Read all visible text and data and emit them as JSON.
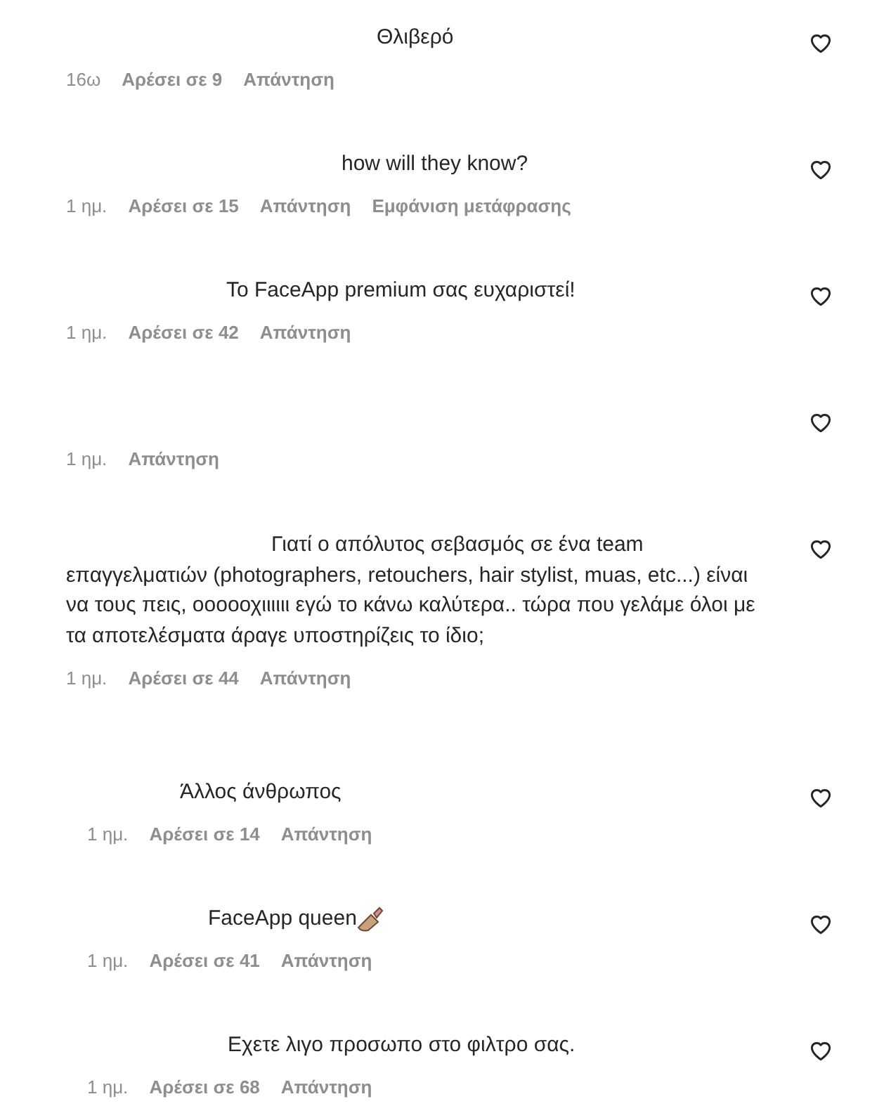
{
  "comments": [
    {
      "kind": "comment",
      "text": "Θλιβερό",
      "time": "16ω",
      "likes": "Αρέσει σε 9",
      "reply": "Απάντηση"
    },
    {
      "kind": "comment",
      "text": "how will they know?",
      "time": "1 ημ.",
      "likes": "Αρέσει σε 15",
      "reply": "Απάντηση",
      "translate": "Εμφάνιση μετάφρασης"
    },
    {
      "kind": "comment",
      "text": "Το FaceApp premium σας ευχαριστεί!",
      "time": "1 ημ.",
      "likes": "Αρέσει σε 42",
      "reply": "Απάντηση"
    },
    {
      "kind": "comment",
      "time": "1 ημ.",
      "reply": "Απάντηση"
    },
    {
      "kind": "comment",
      "text": "Γιατί ο απόλυτος σεβασμός σε ένα team επαγγελματιών (photographers, retouchers, hair stylist, muas, etc...) είναι να τους πεις, οοοοοχιιιιιι εγώ το κάνω καλύτερα.. τώρα που γελάμε όλοι με τα αποτελέσματα άραγε υποστηρίζεις το ίδιο;",
      "time": "1 ημ.",
      "likes": "Αρέσει σε 44",
      "reply": "Απάντηση"
    },
    {
      "kind": "reply",
      "text": "Άλλος άνθρωπος",
      "time": "1 ημ.",
      "likes": "Αρέσει σε 14",
      "reply": "Απάντηση"
    },
    {
      "kind": "reply",
      "text": "FaceApp queen",
      "emoji": true,
      "time": "1 ημ.",
      "likes": "Αρέσει σε 41",
      "reply": "Απάντηση"
    },
    {
      "kind": "reply",
      "text": "Εχετε λιγο προσωπο στο φιλτρο σας.",
      "time": "1 ημ.",
      "likes": "Αρέσει σε 68",
      "reply": "Απάντηση"
    }
  ]
}
